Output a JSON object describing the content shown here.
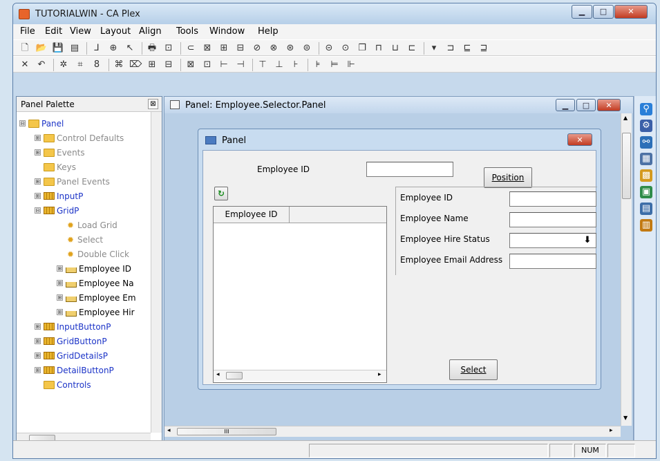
{
  "window": {
    "title": "TUTORIALWIN - CA Plex",
    "min": "▁",
    "max": "□",
    "close": "✕"
  },
  "menu": [
    "File",
    "Edit",
    "View",
    "Layout",
    "Align",
    "Tools",
    "Window",
    "Help"
  ],
  "toolbar1": [
    "🗋",
    "📂",
    "💾",
    "▤",
    "⅃",
    "⊕",
    "↖",
    "🖶",
    "⊡",
    "⊂",
    "⊠",
    "⊞",
    "⊟",
    "⊘",
    "⊗",
    "⊛",
    "⊜",
    "⊝",
    "⊙",
    "❐",
    "⊓",
    "⊔",
    "⊏",
    "▾",
    "⊐",
    "⊑",
    "⊒"
  ],
  "toolbar2": [
    "✕",
    "↶",
    "✲",
    "⌗",
    "8",
    "⌘",
    "⌦",
    "⊞",
    "⊟",
    "⊠",
    "⊡",
    "⊢",
    "⊣",
    "⊤",
    "⊥",
    "⊦",
    "⊧",
    "⊨",
    "⊩"
  ],
  "palette": {
    "title": "Panel Palette",
    "close": "⊠",
    "tree": [
      {
        "label": "Panel",
        "indent": 0,
        "exp": "⊟",
        "icon": "folder",
        "color": "blue"
      },
      {
        "label": "Control Defaults",
        "indent": 1,
        "exp": "⊞",
        "icon": "folder",
        "color": "grey"
      },
      {
        "label": "Events",
        "indent": 1,
        "exp": "⊞",
        "icon": "folder",
        "color": "grey"
      },
      {
        "label": "Keys",
        "indent": 1,
        "exp": "",
        "icon": "folder",
        "color": "grey"
      },
      {
        "label": "Panel Events",
        "indent": 1,
        "exp": "⊞",
        "icon": "folder",
        "color": "grey"
      },
      {
        "label": "InputP",
        "indent": 1,
        "exp": "⊞",
        "icon": "grid",
        "color": "blue"
      },
      {
        "label": "GridP",
        "indent": 1,
        "exp": "⊟",
        "icon": "grid",
        "color": "blue"
      },
      {
        "label": "Load Grid",
        "indent": 2,
        "exp": "",
        "icon": "event",
        "color": "grey"
      },
      {
        "label": "Select",
        "indent": 2,
        "exp": "",
        "icon": "event",
        "color": "grey"
      },
      {
        "label": "Double Click",
        "indent": 2,
        "exp": "",
        "icon": "event",
        "color": "grey"
      },
      {
        "label": "Employee ID",
        "indent": 2,
        "exp": "⊞",
        "icon": "field",
        "color": ""
      },
      {
        "label": "Employee Na",
        "indent": 2,
        "exp": "⊞",
        "icon": "field",
        "color": ""
      },
      {
        "label": "Employee Em",
        "indent": 2,
        "exp": "⊞",
        "icon": "field",
        "color": ""
      },
      {
        "label": "Employee Hir",
        "indent": 2,
        "exp": "⊞",
        "icon": "field",
        "color": ""
      },
      {
        "label": "InputButtonP",
        "indent": 1,
        "exp": "⊞",
        "icon": "grid",
        "color": "blue"
      },
      {
        "label": "GridButtonP",
        "indent": 1,
        "exp": "⊞",
        "icon": "grid",
        "color": "blue"
      },
      {
        "label": "GridDetailsP",
        "indent": 1,
        "exp": "⊞",
        "icon": "grid",
        "color": "blue"
      },
      {
        "label": "DetailButtonP",
        "indent": 1,
        "exp": "⊞",
        "icon": "grid",
        "color": "blue"
      },
      {
        "label": "Controls",
        "indent": 1,
        "exp": "",
        "icon": "folder",
        "color": "blue"
      }
    ]
  },
  "child": {
    "title": "Panel: Employee.Selector.Panel",
    "hscroll_thumb": "III"
  },
  "panel": {
    "title": "Panel",
    "close": "✕",
    "filter_label": "Employee ID",
    "filter_value": "",
    "position_button": "Position",
    "refresh_icon": "↻",
    "grid_header": "Employee ID",
    "details": [
      {
        "label": "Employee ID",
        "value": ""
      },
      {
        "label": "Employee Name",
        "value": ""
      },
      {
        "label": "Employee Hire Status",
        "value": ""
      },
      {
        "label": "Employee Email Address",
        "value": ""
      }
    ],
    "dropdown_arrow": "⬇",
    "select_button": "Select"
  },
  "right_icons": [
    "⚲",
    "⚙",
    "⚯",
    "▦",
    "▩",
    "▣",
    "▤",
    "▥"
  ],
  "status": {
    "num": "NUM"
  }
}
